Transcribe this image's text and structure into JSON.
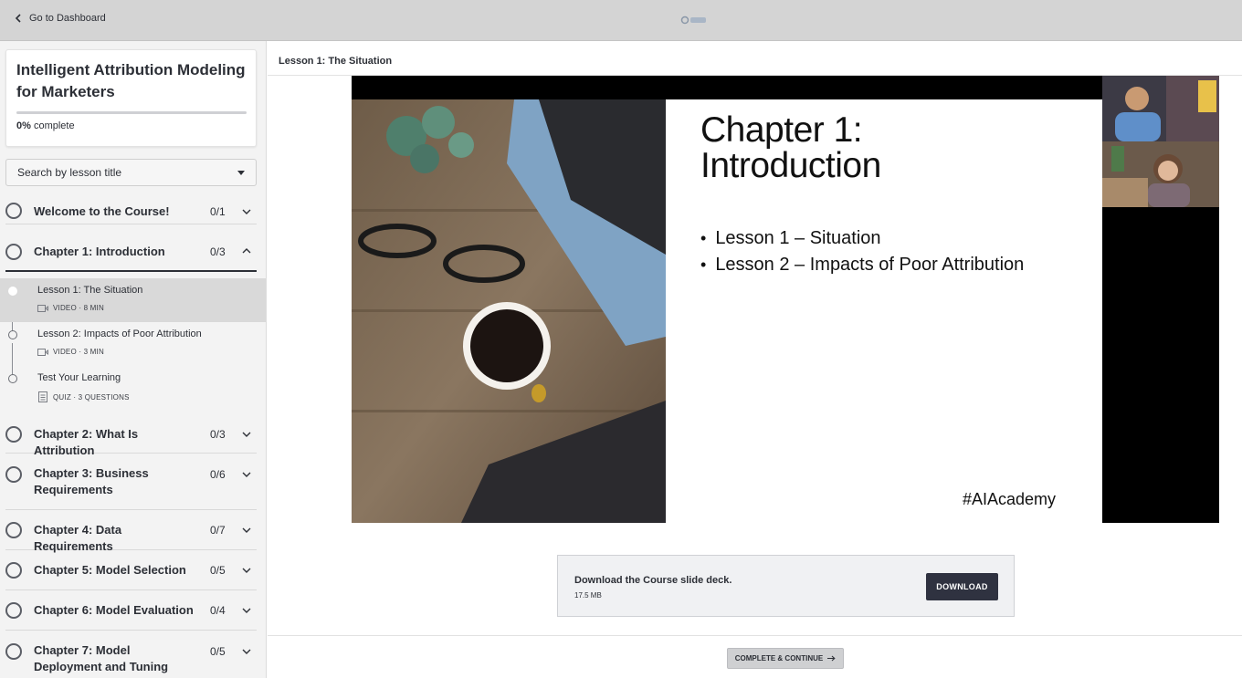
{
  "topbar": {
    "back_label": "Go to Dashboard"
  },
  "course": {
    "title": "Intelligent Attribution Modeling for Marketers",
    "progress_percent": 0,
    "progress_value": "0%",
    "progress_suffix": "complete"
  },
  "search": {
    "placeholder": "Search by lesson title"
  },
  "chapters": [
    {
      "title": "Welcome to the Course!",
      "count": "0/1"
    },
    {
      "title": "Chapter 1: Introduction",
      "count": "0/3"
    },
    {
      "title": "Chapter 2: What Is Attribution",
      "count": "0/3"
    },
    {
      "title": "Chapter 3: Business Requirements",
      "count": "0/6"
    },
    {
      "title": "Chapter 4: Data Requirements",
      "count": "0/7"
    },
    {
      "title": "Chapter 5: Model Selection",
      "count": "0/5"
    },
    {
      "title": "Chapter 6: Model Evaluation",
      "count": "0/4"
    },
    {
      "title": "Chapter 7: Model Deployment and Tuning",
      "count": "0/5"
    }
  ],
  "lessons": [
    {
      "title": "Lesson 1: The Situation",
      "meta": "VIDEO · 8 MIN",
      "icon": "video-icon"
    },
    {
      "title": "Lesson 2: Impacts of Poor Attribution",
      "meta": "VIDEO · 3 MIN",
      "icon": "video-icon"
    },
    {
      "title": "Test Your Learning",
      "meta": "QUIZ · 3 QUESTIONS",
      "icon": "quiz-icon"
    }
  ],
  "main": {
    "lesson_title": "Lesson 1: The Situation",
    "slide": {
      "title_line1": "Chapter 1:",
      "title_line2": "Introduction",
      "bullets": [
        "Lesson 1 – Situation",
        "Lesson 2 – Impacts of Poor Attribution"
      ],
      "hashtag": "#AIAcademy"
    },
    "download": {
      "title": "Download the Course slide deck.",
      "size": "17.5 MB",
      "button": "DOWNLOAD"
    },
    "complete_button": "COMPLETE & CONTINUE"
  },
  "colors": {
    "accent_dark": "#2f3240",
    "sidebar_bg": "#f3f3f3",
    "topbar_bg": "#d4d4d4"
  }
}
